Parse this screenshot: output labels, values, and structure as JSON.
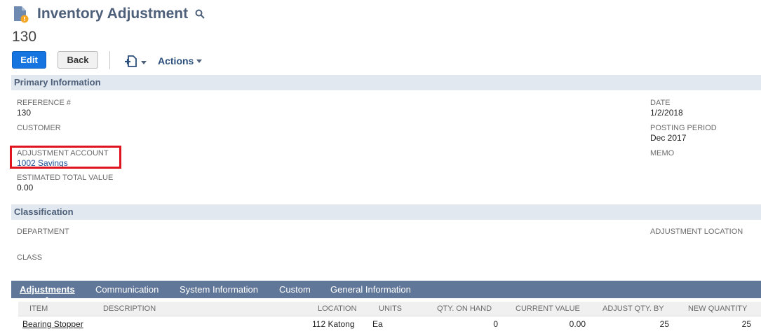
{
  "page": {
    "title": "Inventory Adjustment",
    "record_number": "130"
  },
  "toolbar": {
    "edit_label": "Edit",
    "back_label": "Back",
    "actions_label": "Actions"
  },
  "sections": {
    "primary": "Primary Information",
    "classification": "Classification"
  },
  "primary": {
    "reference_label": "REFERENCE #",
    "reference_value": "130",
    "customer_label": "CUSTOMER",
    "adjustment_account_label": "ADJUSTMENT ACCOUNT",
    "adjustment_account_value": "1002 Savings",
    "estimated_total_label": "ESTIMATED TOTAL VALUE",
    "estimated_total_value": "0.00",
    "date_label": "DATE",
    "date_value": "1/2/2018",
    "posting_period_label": "POSTING PERIOD",
    "posting_period_value": "Dec 2017",
    "memo_label": "MEMO"
  },
  "classification": {
    "department_label": "DEPARTMENT",
    "class_label": "CLASS",
    "adjustment_location_label": "ADJUSTMENT LOCATION"
  },
  "tabs": [
    {
      "label": "Adjustments",
      "active": true
    },
    {
      "label": "Communication",
      "active": false
    },
    {
      "label": "System Information",
      "active": false
    },
    {
      "label": "Custom",
      "active": false
    },
    {
      "label": "General Information",
      "active": false
    }
  ],
  "grid": {
    "headers": [
      "ITEM",
      "DESCRIPTION",
      "LOCATION",
      "UNITS",
      "QTY. ON HAND",
      "CURRENT VALUE",
      "ADJUST QTY. BY",
      "NEW QUANTITY"
    ],
    "rows": [
      {
        "item": "Bearing Stopper",
        "description": "",
        "location": "112 Katong",
        "units": "Ea",
        "qty_on_hand": "0",
        "current_value": "0.00",
        "adjust_qty_by": "25",
        "new_quantity": "25"
      }
    ]
  },
  "colors": {
    "accent": "#1574e0",
    "section_bg": "#e1e8f0",
    "tabbar_bg": "#607799",
    "highlight": "#e0141e"
  },
  "icons": {
    "record": "document-icon",
    "search": "search-icon",
    "new_record": "new-record-icon"
  }
}
